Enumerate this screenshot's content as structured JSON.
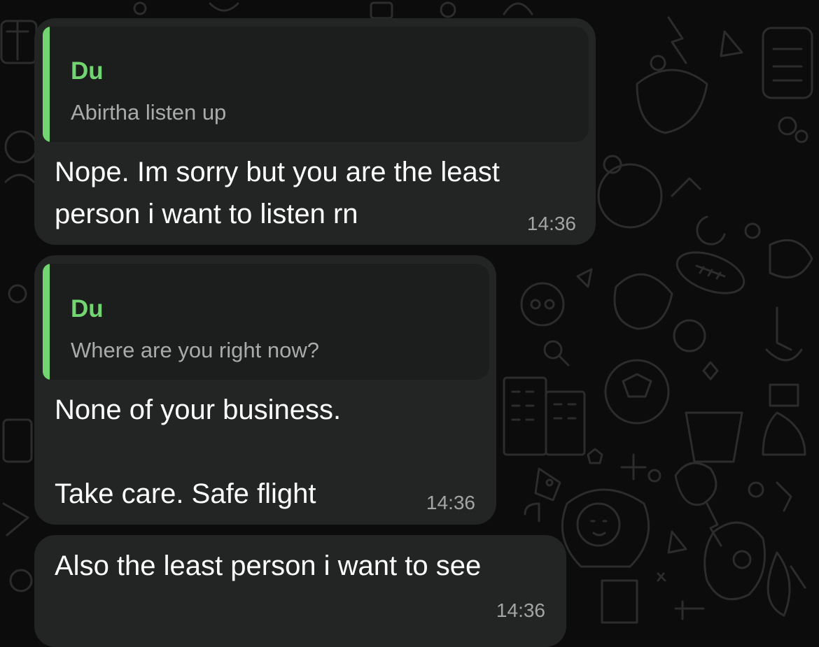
{
  "messages": [
    {
      "reply": {
        "author": "Du",
        "text": "Abirtha listen up"
      },
      "text": "Nope. Im sorry but you are the least\nperson i want to listen rn",
      "time": "14:36"
    },
    {
      "reply": {
        "author": "Du",
        "text": "Where are you right now?"
      },
      "text": "None of your business.\n\nTake care. Safe flight",
      "time": "14:36"
    },
    {
      "text": "Also the least person i want to see",
      "time": "14:36"
    }
  ],
  "colors": {
    "background": "#0c0c0c",
    "bubble": "#232424",
    "quote_background": "#1c1d1d",
    "quote_accent": "#72d572",
    "message_text": "#ffffff",
    "timestamp": "#a3a5a5"
  }
}
